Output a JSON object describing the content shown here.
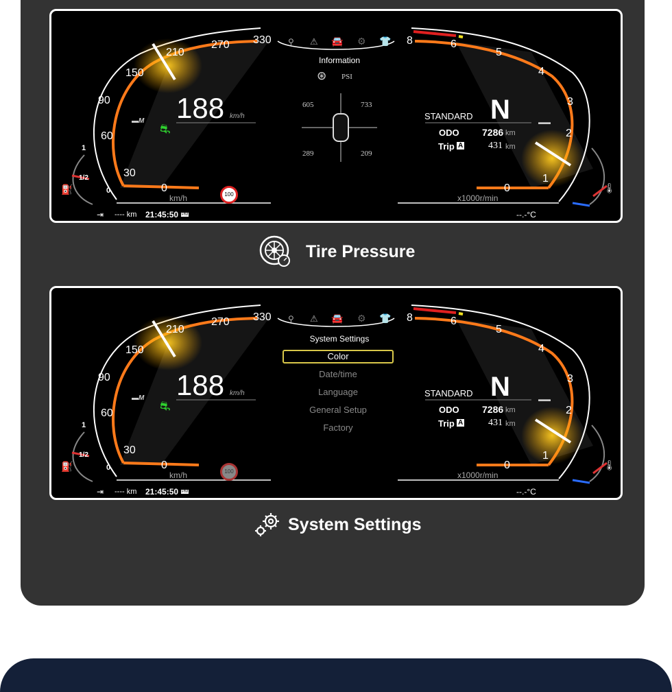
{
  "screens": [
    {
      "speed_ticks": [
        "0",
        "30",
        "60",
        "90",
        "150",
        "210",
        "270",
        "330"
      ],
      "rpm_ticks": [
        "0",
        "1",
        "2",
        "3",
        "4",
        "5",
        "6",
        "8"
      ],
      "fuel_ticks": [
        "0",
        "1/2",
        "1"
      ],
      "speed_value": "188",
      "speed_unit": "km/h",
      "speed_label": "km/h",
      "rpm_label": "x1000r/min",
      "mode": "STANDARD",
      "gear": "N",
      "odo_label": "ODO",
      "odo_value": "7286",
      "odo_unit": "km",
      "trip_label": "Trip",
      "trip_badge": "A",
      "trip_value": "431",
      "trip_unit": "km",
      "range_text": "---- km",
      "clock": "21:45:50",
      "clock_suffix": "PM",
      "temperature": "--.-°C",
      "speed_limit": "100",
      "center": {
        "title": "Information",
        "unit": "PSI",
        "tires": [
          "605",
          "733",
          "289",
          "209"
        ]
      }
    },
    {
      "speed_ticks": [
        "0",
        "30",
        "60",
        "90",
        "150",
        "210",
        "270",
        "330"
      ],
      "rpm_ticks": [
        "0",
        "1",
        "2",
        "3",
        "4",
        "5",
        "6",
        "8"
      ],
      "fuel_ticks": [
        "0",
        "1/2",
        "1"
      ],
      "speed_value": "188",
      "speed_unit": "km/h",
      "speed_label": "km/h",
      "rpm_label": "x1000r/min",
      "mode": "STANDARD",
      "gear": "N",
      "odo_label": "ODO",
      "odo_value": "7286",
      "odo_unit": "km",
      "trip_label": "Trip",
      "trip_badge": "A",
      "trip_value": "431",
      "trip_unit": "km",
      "range_text": "---- km",
      "clock": "21:45:50",
      "clock_suffix": "PM",
      "temperature": "--.-°C",
      "speed_limit": "100",
      "center": {
        "title": "System Settings",
        "menu": [
          "Color",
          "Date/time",
          "Language",
          "General Setup",
          "Factory"
        ],
        "selected": 0
      }
    }
  ],
  "captions": {
    "tire": "Tire Pressure",
    "settings": "System Settings"
  },
  "colors": {
    "accent_orange": "#ff7a1a",
    "needle_glow": "#ffc21a",
    "selection": "#d9c84a",
    "panel": "#333333"
  },
  "icons": [
    "location-icon",
    "warning-icon",
    "car-icon",
    "gear-icon",
    "shirt-icon",
    "tire-icon",
    "fuel-icon",
    "coolant-temp-icon",
    "exit-icon",
    "settings-icon"
  ]
}
